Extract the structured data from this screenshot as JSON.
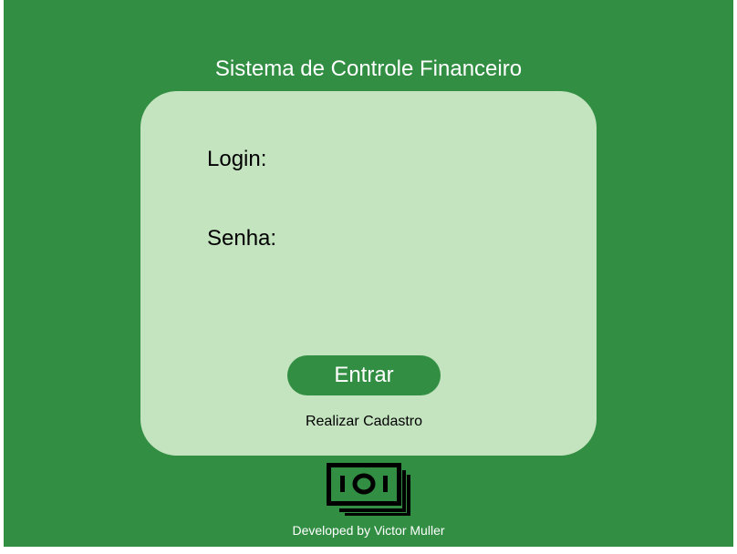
{
  "header": {
    "title": "Sistema de Controle Financeiro"
  },
  "login_form": {
    "login_label": "Login:",
    "login_value": "",
    "password_label": "Senha:",
    "password_value": "",
    "submit_label": "Entrar",
    "register_link": "Realizar Cadastro"
  },
  "footer": {
    "logo_icon": "money-icon",
    "credit": "Developed by Victor Muller"
  },
  "colors": {
    "background": "#328e43",
    "card": "#c4e4c0",
    "button": "#328e43",
    "text_light": "#ffffff",
    "text_dark": "#000000"
  }
}
